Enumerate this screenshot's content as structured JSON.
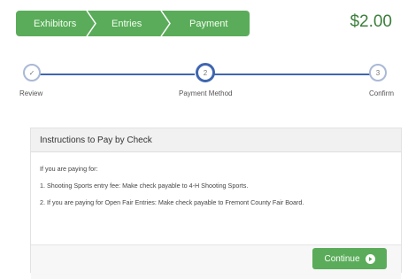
{
  "breadcrumb": {
    "items": [
      "Exhibitors",
      "Entries",
      "Payment"
    ]
  },
  "total": "$2.00",
  "steps": [
    {
      "number": "✓",
      "label": "Review",
      "state": "done"
    },
    {
      "number": "2",
      "label": "Payment Method",
      "state": "active"
    },
    {
      "number": "3",
      "label": "Confirm",
      "state": "pending"
    }
  ],
  "panel": {
    "title": "Instructions to Pay by Check",
    "lines": [
      "If you are paying for:",
      "1. Shooting Sports entry fee: Make check payable to 4-H Shooting Sports.",
      "2. If you are paying for Open Fair Entries: Make check payable to Fremont County Fair Board."
    ],
    "continue_label": "Continue"
  },
  "colors": {
    "accent_green": "#5aac5a",
    "step_blue": "#3f66b0",
    "total_green": "#3c7f3c"
  }
}
